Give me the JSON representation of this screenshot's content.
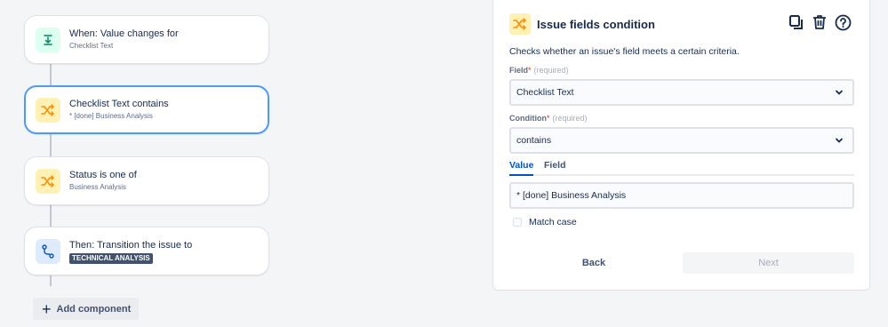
{
  "flow": {
    "cards": [
      {
        "title": "When: Value changes for",
        "sub": "Checklist Text",
        "icon": "trigger-icon"
      },
      {
        "title": "Checklist Text contains",
        "sub": "* [done] Business Analysis",
        "icon": "condition-icon"
      },
      {
        "title": "Status is one of",
        "sub": "Business Analysis",
        "icon": "condition-icon"
      },
      {
        "title": "Then: Transition the issue to",
        "lozenge": "TECHNICAL ANALYSIS",
        "icon": "transition-icon"
      }
    ],
    "add_component_label": "Add component"
  },
  "panel": {
    "title": "Issue fields condition",
    "description": "Checks whether an issue's field meets a certain criteria.",
    "field_label": "Field",
    "field_required_hint": "(required)",
    "field_value": "Checklist Text",
    "condition_label": "Condition",
    "condition_required_hint": "(required)",
    "condition_value": "contains",
    "tabs": [
      {
        "label": "Value"
      },
      {
        "label": "Field"
      }
    ],
    "value_input": "* [done] Business Analysis",
    "match_case_label": "Match case",
    "match_case_checked": false,
    "back_label": "Back",
    "next_label": "Next"
  },
  "colors": {
    "selected_border": "#4c9aff",
    "trigger_bg": "#dcfff1",
    "condition_bg": "#fff0b3",
    "condition_icon": "#ff8b00",
    "action_bg": "#deebff",
    "link_blue": "#0052cc"
  }
}
